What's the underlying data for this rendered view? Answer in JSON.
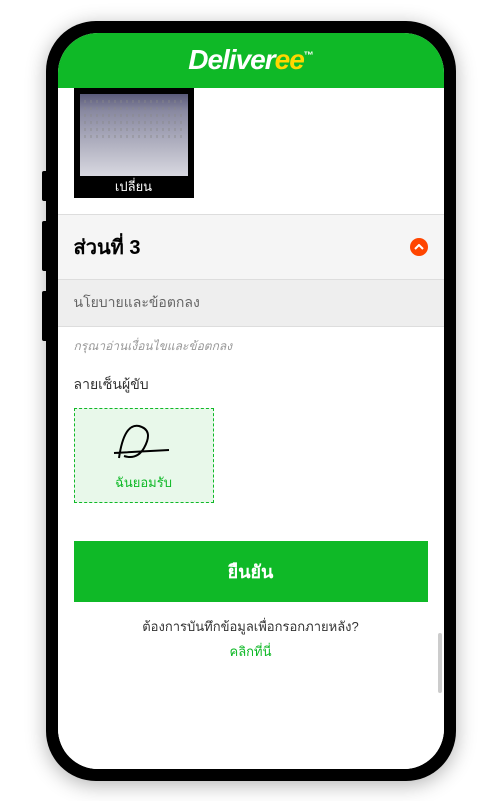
{
  "logo": {
    "part1": "Deliver",
    "part2": "ee",
    "tm": "™"
  },
  "photo": {
    "change_label": "เปลี่ยน"
  },
  "section3": {
    "title": "ส่วนที่ 3",
    "policy_header": "นโยบายและข้อตกลง",
    "policy_note": "กรุณาอ่านเงื่อนไขและข้อตกลง",
    "signature_label": "ลายเซ็นผู้ขับ",
    "accept_label": "ฉันยอมรับ"
  },
  "submit": {
    "button_label": "ยืนยัน",
    "save_question": "ต้องการบันทึกข้อมูลเพื่อกรอกภายหลัง?",
    "click_here": "คลิกที่นี่"
  },
  "colors": {
    "brand_green": "#0fb927",
    "accent_orange": "#ff4500",
    "brand_yellow": "#ffd700"
  }
}
